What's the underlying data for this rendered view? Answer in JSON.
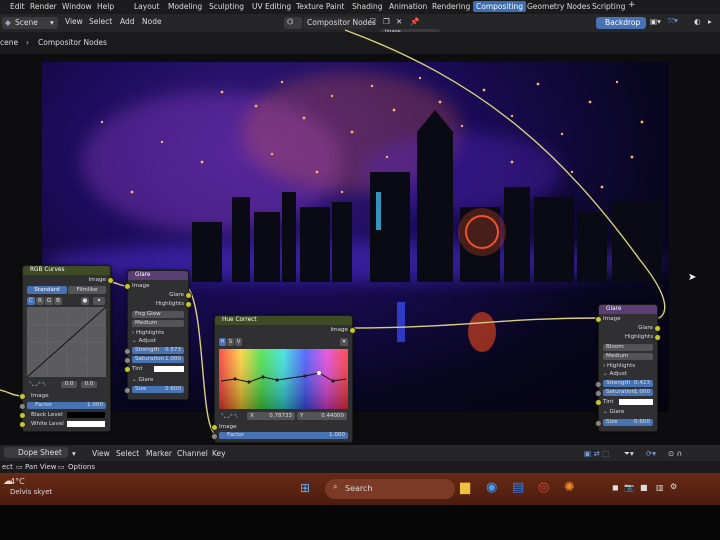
{
  "menubar": {
    "menus": [
      "Edit",
      "Render",
      "Window",
      "Help"
    ],
    "workspaces": [
      "Layout",
      "Modeling",
      "Sculpting",
      "UV Editing",
      "Texture Paint",
      "Shading",
      "Animation",
      "Rendering",
      "Compositing",
      "Geometry Nodes",
      "Scripting"
    ],
    "active_workspace": "Compositing",
    "add_tab": "+"
  },
  "header": {
    "scene_label": "Scene",
    "view": "View",
    "select": "Select",
    "add": "Add",
    "node": "Node",
    "node_tree": "Compositor Nodes",
    "backdrop_button": "Backdrop",
    "floating_label": "Image"
  },
  "breadcrumb": {
    "scene": "cene",
    "tree": "Compositor Nodes"
  },
  "nodes": {
    "rgb_curves": {
      "title": "RGB Curves",
      "output": "Image",
      "tab_standard": "Standard",
      "tab_filmlike": "Filmlike",
      "channels": [
        "C",
        "R",
        "G",
        "B"
      ],
      "val_a": "0.0",
      "val_b": "0.0",
      "input_image": "Image",
      "factor_label": "Factor",
      "factor_value": "1.000",
      "black_level": "Black Level",
      "white_level": "White Level"
    },
    "glare_left": {
      "title": "Glare",
      "input_image": "Image",
      "out_glare": "Glare",
      "out_highlights": "Highlights",
      "type": "Fog Glow",
      "quality": "Medium",
      "highlights_panel": "Highlights",
      "adjust_panel": "Adjust",
      "strength_label": "Strength",
      "strength_value": "0.573",
      "saturation_label": "Saturation",
      "saturation_value": "1.000",
      "tint_label": "Tint",
      "glare_panel": "Glare",
      "size_label": "Size",
      "size_value": "0.600"
    },
    "hue_correct": {
      "title": "Hue Correct",
      "output": "Image",
      "channels": [
        "H",
        "S",
        "V"
      ],
      "x_label": "X",
      "x_value": "0.78733",
      "y_label": "Y",
      "y_value": "0.44000",
      "input_image": "Image",
      "factor_label": "Factor",
      "factor_value": "1.000"
    },
    "glare_right": {
      "title": "Glare",
      "input_image": "Image",
      "out_glare": "Glare",
      "out_highlights": "Highlights",
      "type": "Bloom",
      "quality": "Medium",
      "highlights_panel": "Highlights",
      "adjust_panel": "Adjust",
      "strength_label": "Strength",
      "strength_value": "0.423",
      "saturation_label": "Saturation",
      "saturation_value": "1.000",
      "tint_label": "Tint",
      "glare_panel": "Glare",
      "size_label": "Size",
      "size_value": "0.600"
    }
  },
  "dopesheet": {
    "mode": "Dope Sheet",
    "menus": [
      "View",
      "Select",
      "Marker",
      "Channel",
      "Key"
    ]
  },
  "statusbar": {
    "left": "ect",
    "pan_view": "Pan View",
    "options": "Options"
  },
  "taskbar": {
    "temperature": "4°C",
    "weather": "Delvis skyet",
    "search_placeholder": "Search"
  },
  "colors": {
    "accent": "#3b6fb1",
    "socket_yellow": "#c7c729",
    "wire": "#d8d07a",
    "taskbar": "#5a2412"
  }
}
